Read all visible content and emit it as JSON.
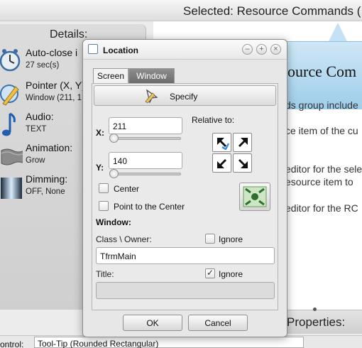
{
  "app": {
    "header_title": "Selected: Resource Commands (",
    "details": {
      "title": "Details:",
      "items": [
        {
          "label": "Auto-close i",
          "value": "27 sec(s)",
          "icon": "clock-icon"
        },
        {
          "label": "Pointer (X, Y)",
          "value": "Window (211, 1",
          "icon": "pointer-icon"
        },
        {
          "label": "Audio:",
          "value": "TEXT",
          "icon": "music-note-icon"
        },
        {
          "label": "Animation:",
          "value": "Grow",
          "icon": "animation-icon"
        },
        {
          "label": "Dimming:",
          "value": "OFF, None",
          "icon": "dimming-icon"
        }
      ]
    },
    "bubble_text": "ource Com",
    "right_text": [
      "ds group include",
      "ce item of the cu",
      "editor for the sele",
      "esource item to",
      "editor for the RC"
    ],
    "properties_label": "Properties:",
    "bottom": {
      "label": "ontrol:",
      "value": "Tool-Tip (Rounded Rectangular)"
    }
  },
  "dialog": {
    "title": "Location",
    "tabs": [
      {
        "label": "Screen",
        "active": false
      },
      {
        "label": "Window",
        "active": true
      }
    ],
    "specify_label": "Specify",
    "x_label": "X:",
    "x_value": "211",
    "y_label": "Y:",
    "y_value": "140",
    "relative_to_label": "Relative to:",
    "relative_options": [
      "top-left",
      "top-right",
      "bottom-left",
      "bottom-right"
    ],
    "relative_selected": "top-left",
    "center_label": "Center",
    "center_checked": false,
    "point_center_label": "Point to the Center",
    "point_center_checked": false,
    "window_section_label": "Window:",
    "class_owner_label": "Class \\ Owner:",
    "class_ignore_label": "Ignore",
    "class_ignore_checked": false,
    "class_owner_value": "TfrmMain",
    "title_label": "Title:",
    "title_ignore_label": "Ignore",
    "title_ignore_checked": true,
    "title_value": "",
    "ok_label": "OK",
    "cancel_label": "Cancel"
  },
  "colors": {
    "accent_tab": "#7a7a7a",
    "bubble": "#b7dbf1",
    "arrow_selected": "#3d8fd6"
  }
}
